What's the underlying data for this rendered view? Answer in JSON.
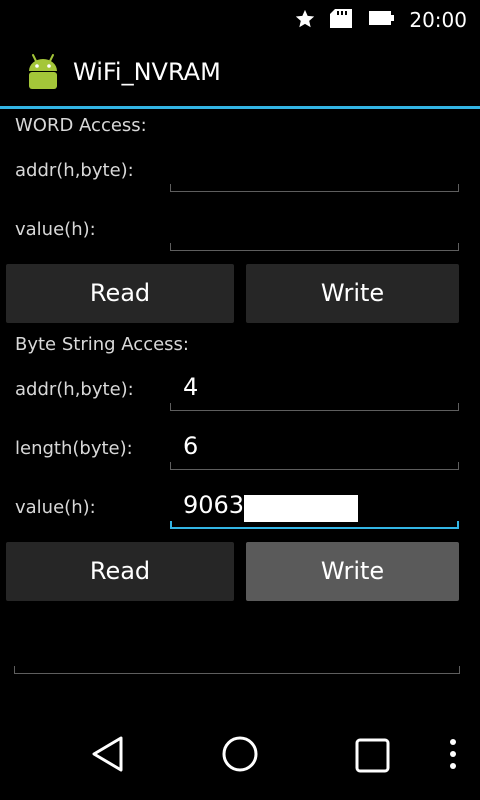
{
  "status_bar": {
    "time": "20:00",
    "icons": [
      "star-icon",
      "sd-card-icon",
      "battery-icon"
    ]
  },
  "app": {
    "title": "WiFi_NVRAM",
    "icon": "android-icon"
  },
  "word_access": {
    "heading": "WORD Access:",
    "addr_label": "addr(h,byte):",
    "addr_value": "",
    "value_label": "value(h):",
    "value_value": "",
    "read_label": "Read",
    "write_label": "Write"
  },
  "byte_string_access": {
    "heading": "Byte String Access:",
    "addr_label": "addr(h,byte):",
    "addr_value": "4",
    "length_label": "length(byte):",
    "length_value": "6",
    "value_label": "value(h):",
    "value_value": "9063",
    "read_label": "Read",
    "write_label": "Write"
  },
  "navigation": {
    "icons": [
      "back-icon",
      "home-icon",
      "recents-icon",
      "overflow-menu-icon"
    ]
  },
  "colors": {
    "accent": "#33b5e5",
    "background": "#000000",
    "button": "#262626",
    "button_pressed": "#5a5a5a",
    "android_green": "#a4c639"
  }
}
